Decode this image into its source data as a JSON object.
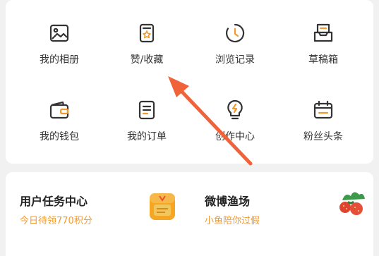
{
  "grid": {
    "items": [
      {
        "label": "我的相册",
        "icon": "photo-album-icon"
      },
      {
        "label": "赞/收藏",
        "icon": "favorite-badge-icon"
      },
      {
        "label": "浏览记录",
        "icon": "history-clock-icon"
      },
      {
        "label": "草稿箱",
        "icon": "drafts-tray-icon"
      },
      {
        "label": "我的钱包",
        "icon": "wallet-icon"
      },
      {
        "label": "我的订单",
        "icon": "order-list-icon"
      },
      {
        "label": "创作中心",
        "icon": "lightbulb-icon"
      },
      {
        "label": "粉丝头条",
        "icon": "calendar-icon"
      }
    ]
  },
  "tasks": {
    "user_task": {
      "title": "用户任务中心",
      "subtitle": "今日待领770积分",
      "icon": "reward-pouch-icon"
    },
    "fishing": {
      "title": "微博渔场",
      "subtitle": "小鱼陪你过假",
      "icon": "strawberry-plant-icon"
    }
  },
  "colors": {
    "accent": "#f29a2e",
    "arrow": "#f0623a",
    "icon_stroke": "#333333"
  }
}
